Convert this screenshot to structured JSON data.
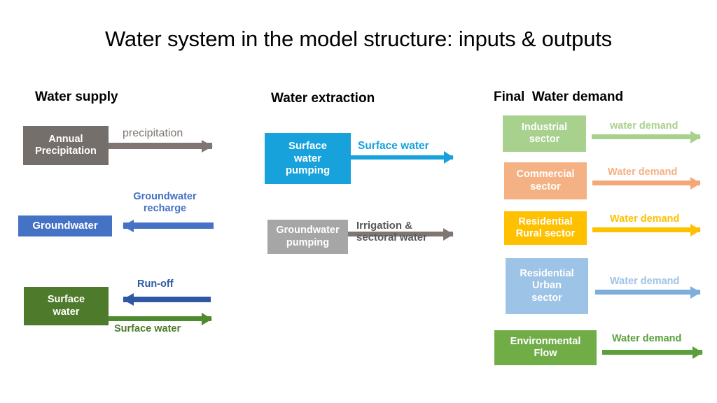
{
  "slide": {
    "title": "Water system in the model structure: inputs & outputs",
    "background": "#FFFFFF"
  },
  "sections": {
    "supply": {
      "heading": "Water supply"
    },
    "extraction": {
      "heading": "Water extraction"
    },
    "demand": {
      "heading": "Final  Water demand"
    }
  },
  "supply_rows": [
    {
      "box_label": "Annual\nPrecipitation",
      "box_color": "#756F6C",
      "arrow_label": "precipitation",
      "arrow_label_color": "#7F7672",
      "arrow_color": "#7F7672",
      "direction": "right"
    },
    {
      "box_label": "Groundwater",
      "box_color": "#4472C4",
      "arrow_label": "Groundwater\nrecharge",
      "arrow_label_color": "#4472C4",
      "arrow_color": "#4472C4",
      "direction": "left"
    },
    {
      "box_label": "Surface\nwater",
      "box_color": "#4E7B2B",
      "arrow_label": "Run-off",
      "arrow_label_color": "#2E58A6",
      "arrow_color": "#2E58A6",
      "direction": "left",
      "arrow_label_2": "Surface water",
      "arrow_label_2_color": "#4E7B2B",
      "arrow_color_2": "#4E8A2F",
      "direction_2": "right"
    }
  ],
  "extraction_rows": [
    {
      "box_label": "Surface\nwater\npumping",
      "box_color": "#17A2DC",
      "arrow_label": "Surface water",
      "arrow_label_color": "#17A2DC",
      "arrow_color": "#17A2DC",
      "direction": "right"
    },
    {
      "box_label": "Groundwater\npumping",
      "box_color": "#A6A6A6",
      "arrow_label": "Irrigation &\nsectoral water",
      "arrow_label_color": "#595959",
      "arrow_color": "#7F7672",
      "direction": "right"
    }
  ],
  "demand_rows": [
    {
      "box_label": "Industrial\nsector",
      "box_color": "#A9D18E",
      "arrow_label": "water demand",
      "arrow_label_color": "#A9D18E",
      "arrow_color": "#A9D18E",
      "direction": "right"
    },
    {
      "box_label": "Commercial\nsector",
      "box_color": "#F4B183",
      "arrow_label": "Water demand",
      "arrow_label_color": "#F4B183",
      "arrow_color": "#F4A877",
      "direction": "right"
    },
    {
      "box_label": "Residential\nRural sector",
      "box_color": "#FFC000",
      "arrow_label": "Water demand",
      "arrow_label_color": "#FFC000",
      "arrow_color": "#FFC000",
      "direction": "right"
    },
    {
      "box_label": "Residential\nUrban\nsector",
      "box_color": "#9DC3E6",
      "arrow_label": "Water demand",
      "arrow_label_color": "#9DC3E6",
      "arrow_color": "#7FAEDC",
      "direction": "right"
    },
    {
      "box_label": "Environmental\nFlow",
      "box_color": "#70AD47",
      "arrow_label": "Water demand",
      "arrow_label_color": "#5B9E3C",
      "arrow_color": "#5B9E3C",
      "direction": "right"
    }
  ]
}
